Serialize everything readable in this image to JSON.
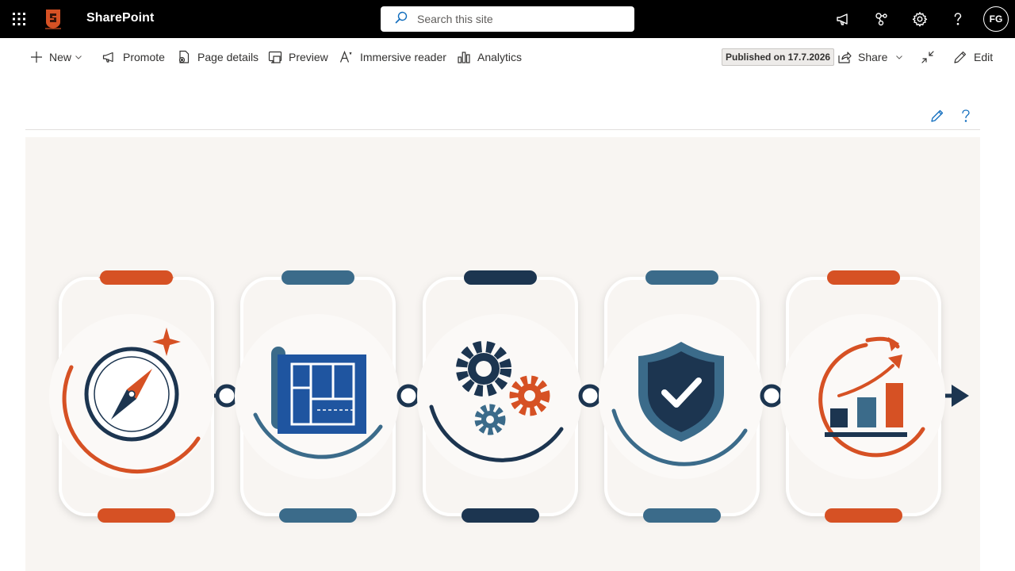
{
  "suitebar": {
    "app_name": "SharePoint",
    "search_placeholder": "Search this site",
    "icons": [
      "waffle-icon",
      "megaphone-icon",
      "share-nodes-icon",
      "settings-icon",
      "help-icon"
    ],
    "avatar_initials": "FG"
  },
  "commandbar": {
    "new_label": "New",
    "promote_label": "Promote",
    "page_details_label": "Page details",
    "preview_label": "Preview",
    "immersive_reader_label": "Immersive reader",
    "analytics_label": "Analytics",
    "published_badge": "Published on 17.7.2026",
    "share_label": "Share",
    "edit_label": "Edit"
  },
  "hero": {
    "steps": [
      {
        "icon": "compass-icon",
        "color": "#d65124"
      },
      {
        "icon": "blueprint-icon",
        "color": "#3b6b8a"
      },
      {
        "icon": "gears-icon",
        "color": "#1c3550"
      },
      {
        "icon": "shield-check-icon",
        "color": "#3b6b8a"
      },
      {
        "icon": "growth-chart-icon",
        "color": "#d65124"
      }
    ]
  },
  "colors": {
    "suitebar_bg": "#000000",
    "accent_orange": "#d65124",
    "accent_teal": "#3b6b8a",
    "accent_navy": "#1c3550",
    "edit_pencil": "#0f6cbd"
  }
}
